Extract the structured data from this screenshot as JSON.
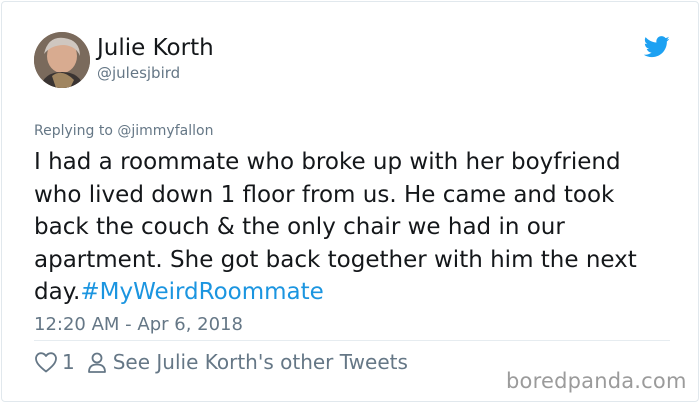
{
  "author": {
    "display_name": "Julie Korth",
    "handle": "@julesjbird"
  },
  "tweet": {
    "replying_to": "Replying to @jimmyfallon",
    "text": "I had a roommate who broke up with her boyfriend who lived down 1 floor from us.  He came and took back the couch & the only chair we had in our apartment.  She got back together with him the next day.",
    "hashtag": "#MyWeirdRoommate",
    "timestamp": "12:20 AM - Apr 6, 2018"
  },
  "actions": {
    "like_count": "1",
    "profile_link": "See Julie Korth's other Tweets"
  },
  "watermark": "boredpanda.com",
  "colors": {
    "twitter_blue": "#1da1f2",
    "hashtag_blue": "#1b95e0",
    "secondary_text": "#657786"
  }
}
